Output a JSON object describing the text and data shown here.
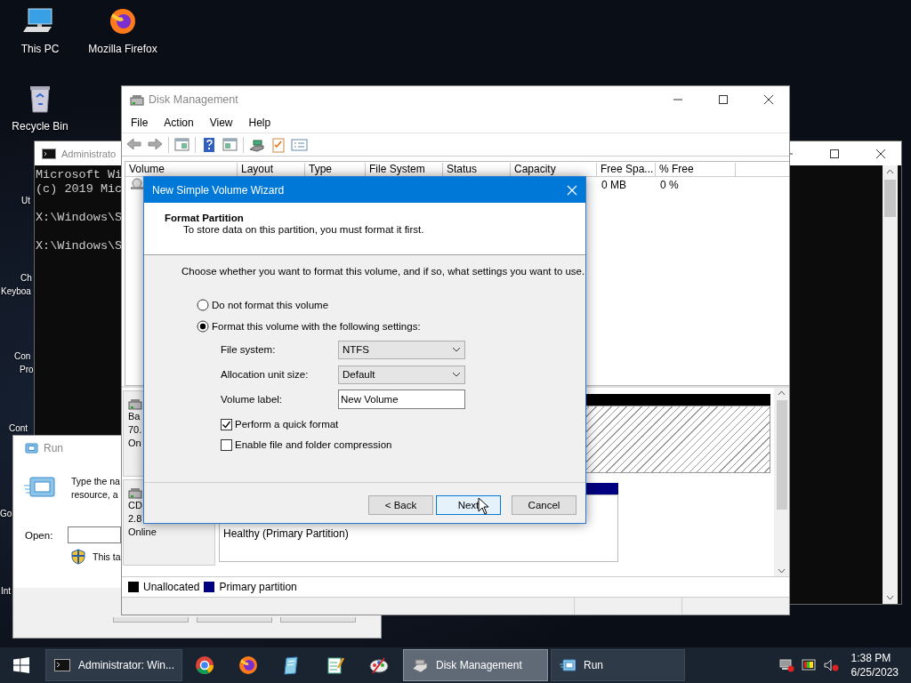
{
  "desktop": {
    "icons": [
      {
        "label": "This PC"
      },
      {
        "label": "Mozilla Firefox"
      },
      {
        "label": "Recycle Bin"
      }
    ],
    "partial_labels": [
      "Ut",
      "Ch",
      "Keyboa",
      "Con",
      "Pro",
      "Cont",
      "Go",
      "Int"
    ]
  },
  "console_window": {
    "title": "Administrato",
    "blocks": [
      [
        "Microsoft Wi",
        "(c) 2019 Mic"
      ],
      [
        "X:\\Windows\\S"
      ],
      [
        "X:\\Windows\\S"
      ]
    ]
  },
  "run_dialog": {
    "title": "Run",
    "description_lines": [
      "Type the na",
      "resource, a"
    ],
    "open_label": "Open:",
    "note": "This ta"
  },
  "disk_management": {
    "title": "Disk Management",
    "menu": [
      "File",
      "Action",
      "View",
      "Help"
    ],
    "columns": [
      "Volume",
      "Layout",
      "Type",
      "File System",
      "Status",
      "Capacity",
      "Free Spa...",
      "% Free"
    ],
    "rows": [
      {
        "free_space": "0 MB",
        "percent_free": "0 %"
      }
    ],
    "disks": [
      {
        "lines": [
          "Ba",
          "70.",
          "On"
        ],
        "partition": {
          "kind": "unallocated"
        }
      },
      {
        "lines": [
          "CD",
          "2.8",
          "Online"
        ],
        "partition": {
          "kind": "primary",
          "status": "Healthy (Primary Partition)"
        }
      }
    ],
    "legend": [
      {
        "label": "Unallocated",
        "color": "#000000"
      },
      {
        "label": "Primary partition",
        "color": "#000080"
      }
    ]
  },
  "wizard": {
    "title": "New Simple Volume Wizard",
    "heading": "Format Partition",
    "subheading": "To store data on this partition, you must format it first.",
    "prompt": "Choose whether you want to format this volume, and if so, what settings you want to use.",
    "options": [
      {
        "label": "Do not format this volume",
        "selected": false
      },
      {
        "label": "Format this volume with the following settings:",
        "selected": true
      }
    ],
    "fields": [
      {
        "kind": "dropdown",
        "label": "File system:",
        "value": "NTFS"
      },
      {
        "kind": "dropdown",
        "label": "Allocation unit size:",
        "value": "Default"
      },
      {
        "kind": "text",
        "label": "Volume label:",
        "value": "New Volume"
      }
    ],
    "checkboxes": [
      {
        "label": "Perform a quick format",
        "checked": true
      },
      {
        "label": "Enable file and folder compression",
        "checked": false
      }
    ],
    "buttons": [
      {
        "label": "< Back",
        "focused": false
      },
      {
        "label": "Next",
        "focused": true
      },
      {
        "label": "Cancel",
        "focused": false
      }
    ]
  },
  "taskbar": {
    "windows": [
      {
        "label": "Administrator: Win...",
        "active": false
      },
      {
        "label": "Disk Management",
        "active": true
      },
      {
        "label": "Run",
        "active": false
      }
    ],
    "time": "1:38 PM",
    "date": "6/25/2023"
  }
}
